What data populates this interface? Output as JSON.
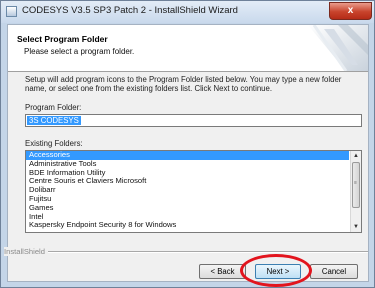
{
  "window": {
    "title": "CODESYS V3.5 SP3 Patch 2 - InstallShield Wizard",
    "close_glyph": "x"
  },
  "header": {
    "title": "Select Program Folder",
    "subtitle": "Please select a program folder."
  },
  "body": {
    "instructions": "Setup will add program icons to the Program Folder listed below.  You may type a new folder name, or select one from the existing folders list.  Click Next to continue.",
    "program_folder_label": "Program Folder:",
    "program_folder_value": "3S CODESYS",
    "existing_folders_label": "Existing Folders:",
    "existing_folders": [
      "Accessories",
      "Administrative Tools",
      "BDE Information Utility",
      "Centre Souris et Claviers Microsoft",
      "Dolibarr",
      "Fujitsu",
      "Games",
      "Intel",
      "Kaspersky Endpoint Security 8 for Windows"
    ],
    "selected_folder_index": 0
  },
  "footer": {
    "brand": "InstallShield",
    "back_label": "< Back",
    "next_label": "Next >",
    "cancel_label": "Cancel"
  },
  "annotation": {
    "highlight_color": "#e2141d",
    "highlighted_target": "Next >"
  }
}
